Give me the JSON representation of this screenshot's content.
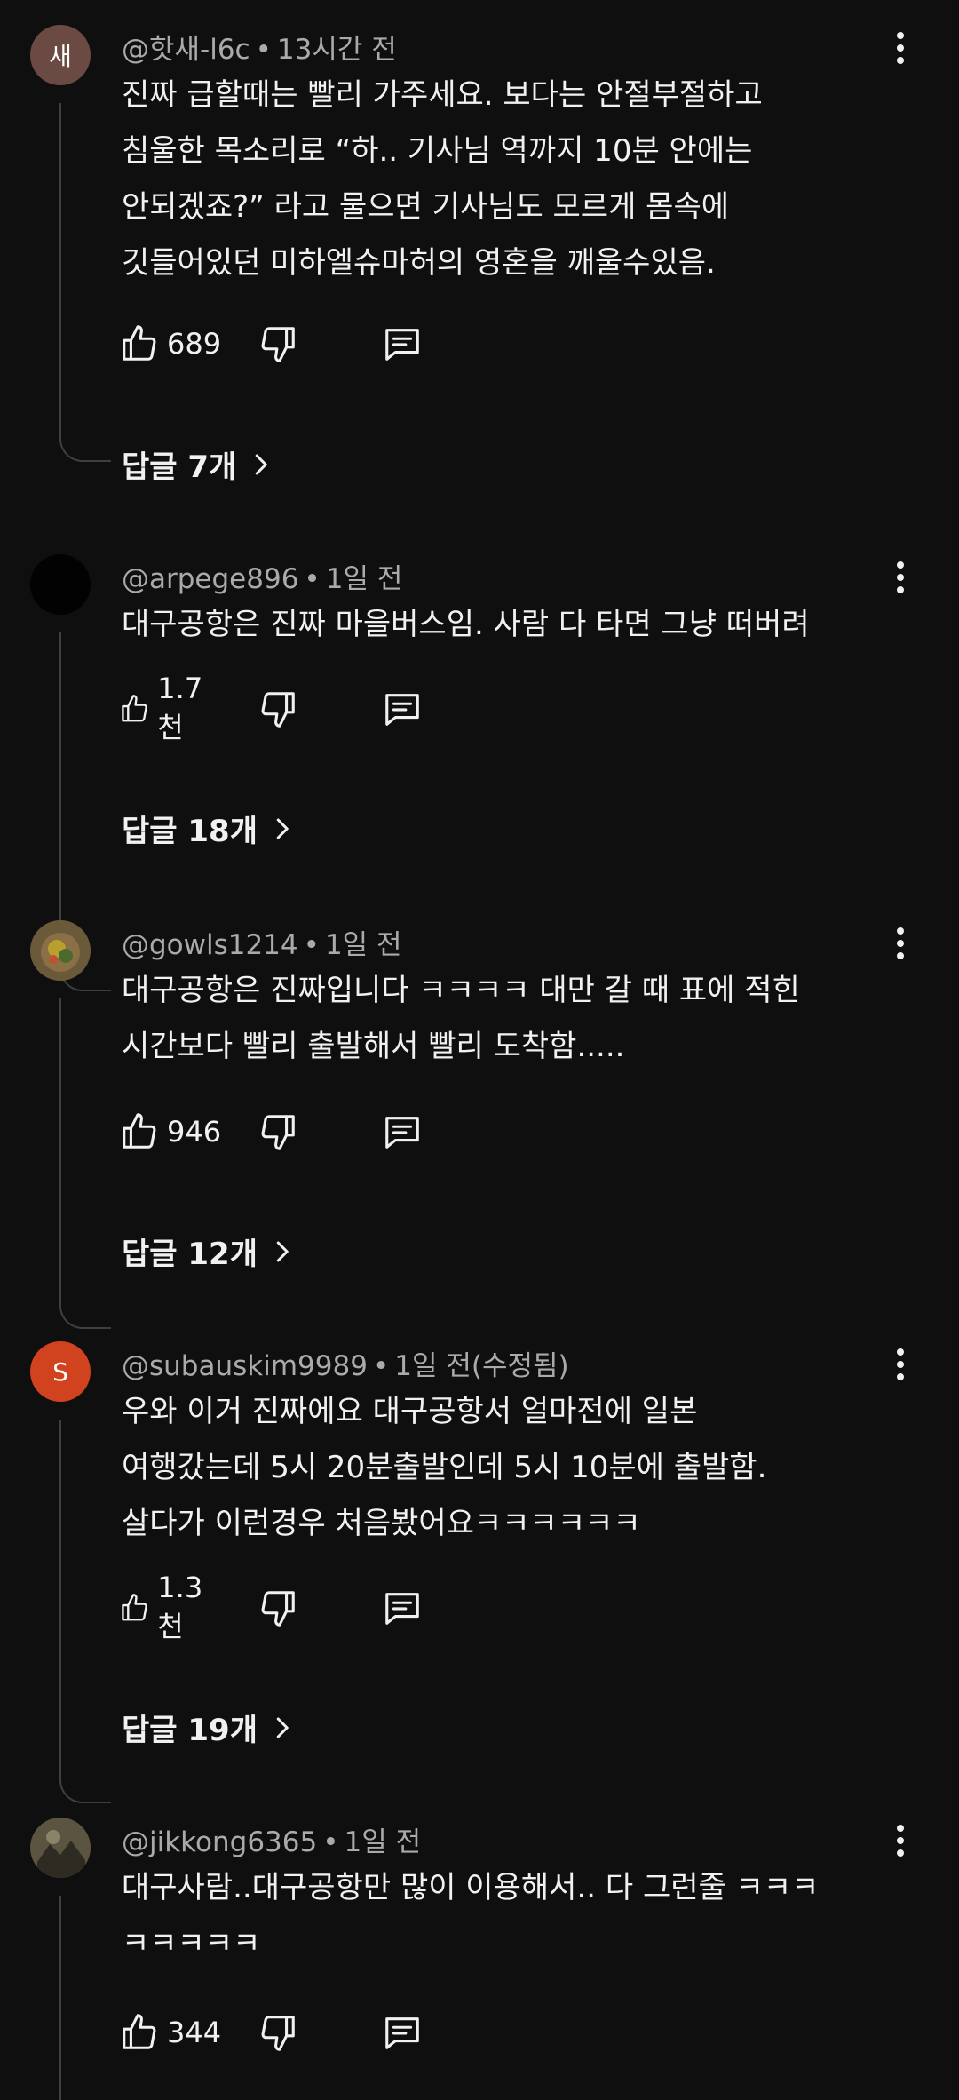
{
  "comments": [
    {
      "avatar_text": "새",
      "avatar_color": "#6b4a43",
      "handle": "@핫새-l6c",
      "time": "13시간 전",
      "lines": [
        "진짜 급할때는 빨리 가주세요. 보다는 안절부절하고",
        "침울한 목소리로 “하.. 기사님 역까지 10분 안에는",
        "안되겠죠?” 라고 물으면 기사님도 모르게 몸속에",
        "깃들어있던 미하엘슈마허의 영혼을 깨울수있음."
      ],
      "likes": "689",
      "replies": "답글 7개"
    },
    {
      "avatar_text": "",
      "avatar_color": "#020202",
      "handle": "@arpege896",
      "time": "1일 전",
      "lines": [
        "대구공항은 진짜 마을버스임. 사람 다 타면 그냥 떠버려"
      ],
      "likes": "1.7천",
      "replies": "답글 18개"
    },
    {
      "avatar_text": "",
      "avatar_color": "#5a4a2c",
      "handle": "@gowls1214",
      "time": "1일 전",
      "lines": [
        "대구공항은 진짜입니다 ㅋㅋㅋㅋ 대만 갈 때 표에 적힌",
        "시간보다 빨리 출발해서 빨리 도착함....."
      ],
      "likes": "946",
      "replies": "답글 12개"
    },
    {
      "avatar_text": "S",
      "avatar_color": "#d1421e",
      "handle": "@subauskim9989",
      "time": "1일 전(수정됨)",
      "lines": [
        "우와 이거 진짜에요 대구공항서 얼마전에 일본",
        "여행갔는데 5시 20분출발인데 5시 10분에 출발함.",
        "살다가 이런경우 처음봤어요ㅋㅋㅋㅋㅋㅋ"
      ],
      "likes": "1.3천",
      "replies": "답글 19개"
    },
    {
      "avatar_text": "",
      "avatar_color": "#4a4636",
      "handle": "@jikkong6365",
      "time": "1일 전",
      "lines": [
        "대구사람..대구공항만 많이 이용해서.. 다 그런줄 ㅋㅋㅋ",
        "ㅋㅋㅋㅋㅋ"
      ],
      "likes": "344",
      "replies": ""
    }
  ],
  "separator": "•",
  "icons": {
    "like": "thumbs-up-icon",
    "dislike": "thumbs-down-icon",
    "reply": "comment-icon",
    "menu": "more-vert-icon",
    "chevron": "chevron-right-icon"
  }
}
